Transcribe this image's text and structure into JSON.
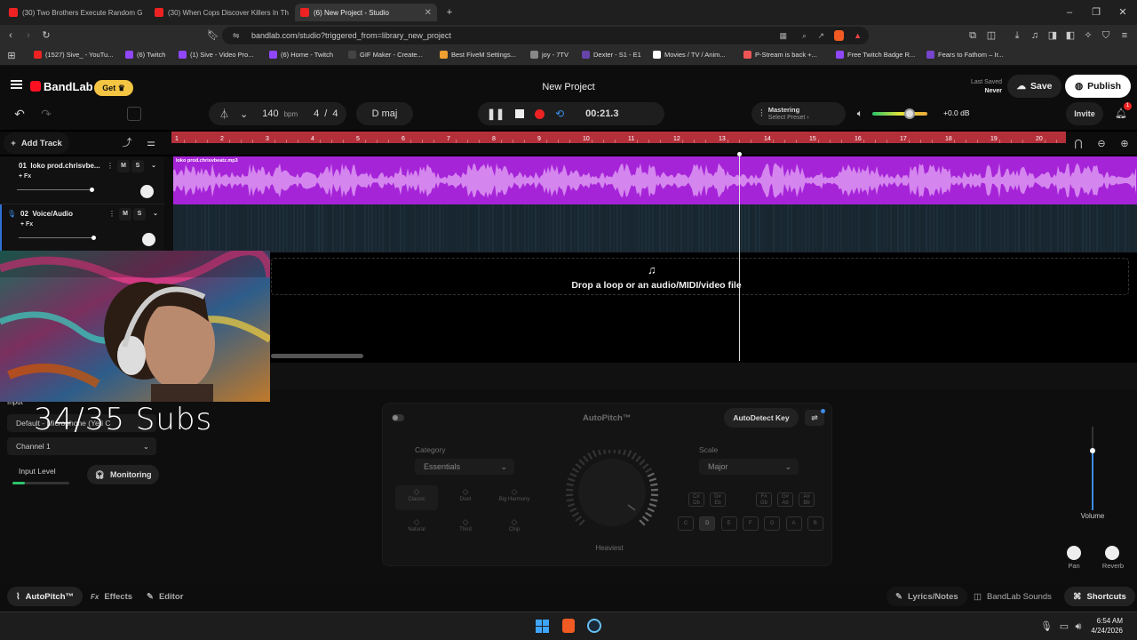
{
  "browser": {
    "tabs": [
      {
        "label": "(30) Two Brothers Execute Random G"
      },
      {
        "label": "(30) When Cops Discover Killers In Th"
      },
      {
        "label": "(6) New Project - Studio"
      }
    ],
    "new_tab_icon": "plus-icon",
    "url": "bandlab.com/studio?triggered_from=library_new_project",
    "bookmarks": [
      {
        "label": "(1527) Sive_ - YouTu...",
        "color": "#e22"
      },
      {
        "label": "(6) Twitch",
        "color": "#9146ff"
      },
      {
        "label": "(1) Sive - Video Pro...",
        "color": "#9146ff"
      },
      {
        "label": "(6) Home - Twitch",
        "color": "#9146ff"
      },
      {
        "label": "GIF Maker - Create...",
        "color": "#444"
      },
      {
        "label": "Best FiveM Settings...",
        "color": "#f0a030"
      },
      {
        "label": "joy - 7TV",
        "color": "#888"
      },
      {
        "label": "Dexter - S1 - E1",
        "color": "#6644aa"
      },
      {
        "label": "Movies / TV / Anim...",
        "color": "#fff"
      },
      {
        "label": "P-Stream is back +...",
        "color": "#e55"
      },
      {
        "label": "Free Twitch Badge R...",
        "color": "#9146ff"
      },
      {
        "label": "Fears to Fathom – Ir...",
        "color": "#7744cc"
      }
    ]
  },
  "header": {
    "brand": "BandLab",
    "get_label": "Get",
    "project_title": "New Project",
    "last_saved_label": "Last Saved",
    "last_saved_value": "Never",
    "save_label": "Save",
    "publish_label": "Publish"
  },
  "transport": {
    "bpm": "140",
    "bpm_unit": "bpm",
    "time_sig_num": "4",
    "time_sig_sep": "/",
    "time_sig_den": "4",
    "key": "D maj",
    "time": "00:21.3",
    "mastering_label": "Mastering",
    "mastering_preset": "Select Preset",
    "gain": "+0.0 dB",
    "invite": "Invite",
    "notif_count": "1"
  },
  "tracks_panel": {
    "add_track": "Add Track"
  },
  "ruler": [
    "1",
    "2",
    "3",
    "4",
    "5",
    "6",
    "7",
    "8",
    "9",
    "10",
    "11",
    "12",
    "13",
    "14",
    "15",
    "16",
    "17",
    "18",
    "19",
    "20"
  ],
  "tracks": [
    {
      "number": "01",
      "name": "loko prod.chrisvbe...",
      "fx": "+ Fx",
      "mute": "M",
      "solo": "S",
      "clip": "loko prod.chrisvbeatz.mp3",
      "volume": 0.75
    },
    {
      "number": "02",
      "name": "Voice/Audio",
      "fx": "+ Fx",
      "mute": "M",
      "solo": "S",
      "volume": 0.75
    }
  ],
  "dropzone": {
    "text": "Drop a loop or an audio/MIDI/video file"
  },
  "input_panel": {
    "title": "Input",
    "device": "Default - Microphone (Yeti C",
    "channel": "Channel 1",
    "input_level": "Input Level",
    "monitoring": "Monitoring"
  },
  "overlay": {
    "subs": "34/35 Subs"
  },
  "autopitch": {
    "title": "AutoPitch™",
    "autodetect": "AutoDetect Key",
    "category_label": "Category",
    "category_value": "Essentials",
    "scale_label": "Scale",
    "scale_value": "Major",
    "knob_label": "Heaviest",
    "styles": [
      "Classic",
      "Duet",
      "Big Harmony",
      "Natural",
      "Third",
      "Chip"
    ],
    "sharps": [
      "C#\nDb",
      "D#\nEb",
      "F#\nGb",
      "G#\nAb",
      "A#\nBb"
    ],
    "naturals": [
      "C",
      "D",
      "E",
      "F",
      "G",
      "A",
      "B"
    ]
  },
  "mixer": {
    "volume": "Volume",
    "pan": "Pan",
    "reverb": "Reverb"
  },
  "bottom_bar": {
    "autopitch": "AutoPitch™",
    "effects": "Effects",
    "editor": "Editor",
    "lyrics": "Lyrics/Notes",
    "sounds": "BandLab Sounds",
    "shortcuts": "Shortcuts"
  },
  "taskbar": {
    "time": "6:54 AM",
    "date": "4/24/2026"
  }
}
